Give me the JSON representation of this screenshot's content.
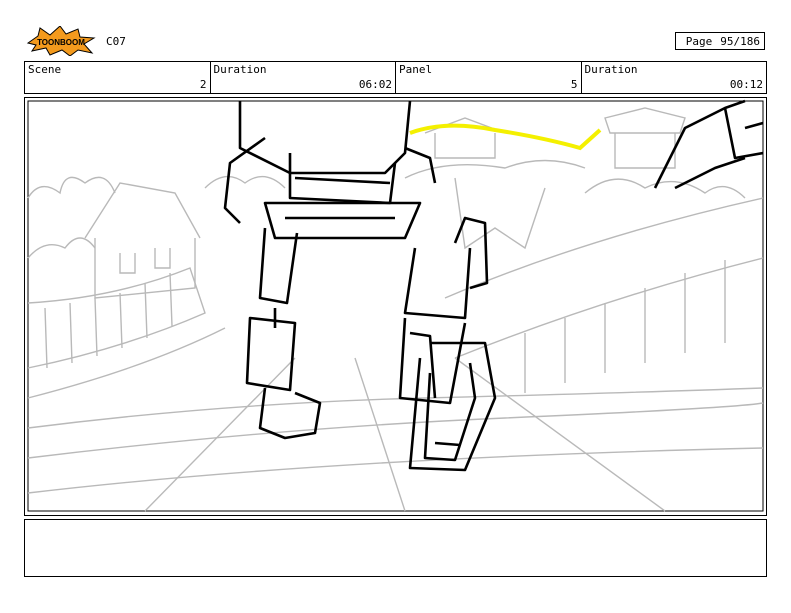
{
  "header": {
    "logo_text": "TOONBOOM",
    "code": "C07",
    "page_label": "Page",
    "page_value": "95/186"
  },
  "info": {
    "scene_label": "Scene",
    "scene_value": "2",
    "duration_label": "Duration",
    "duration_value": "06:02",
    "panel_label": "Panel",
    "panel_value": "5",
    "panel_duration_label": "Duration",
    "panel_duration_value": "00:12"
  },
  "colors": {
    "logo_orange": "#f39a1d",
    "sketch_gray": "#b9b9b9",
    "ink": "#000000",
    "highlight_yellow": "#f4f000"
  }
}
